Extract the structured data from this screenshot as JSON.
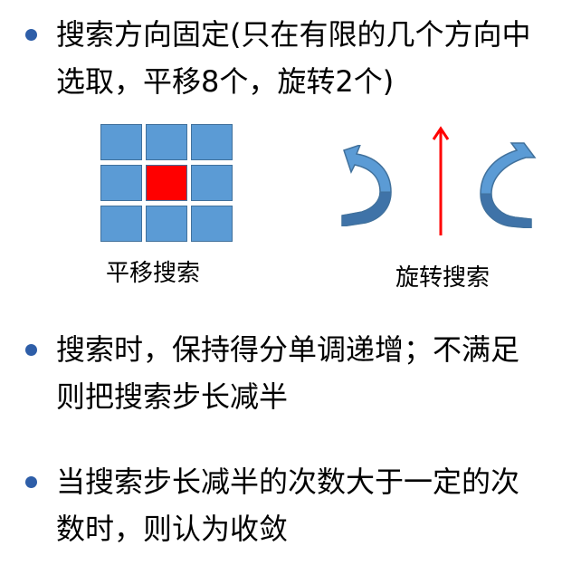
{
  "bullets": [
    {
      "text_line1": "搜索方向固定(只在有限的几个方向中",
      "text_line2": "选取，平移8个，旋转2个)"
    },
    {
      "text_line1": "搜索时，保持得分单调递增；不满足",
      "text_line2": "则把搜索步长减半"
    },
    {
      "text_line1": "当搜索步长减半的次数大于一定的次",
      "text_line2": "数时，则认为收敛"
    }
  ],
  "diagram": {
    "translate_caption": "平移搜索",
    "rotate_caption": "旋转搜索",
    "grid_rows": 3,
    "grid_cols": 3,
    "center_highlighted": true
  },
  "colors": {
    "bullet_dot": "#2e5ea8",
    "cell_fill": "#5b9bd5",
    "cell_border": "#41719c",
    "center_fill": "#ff0000",
    "arrow_up": "#ff0000",
    "curved_arrow_fill": "#5b9bd5"
  }
}
